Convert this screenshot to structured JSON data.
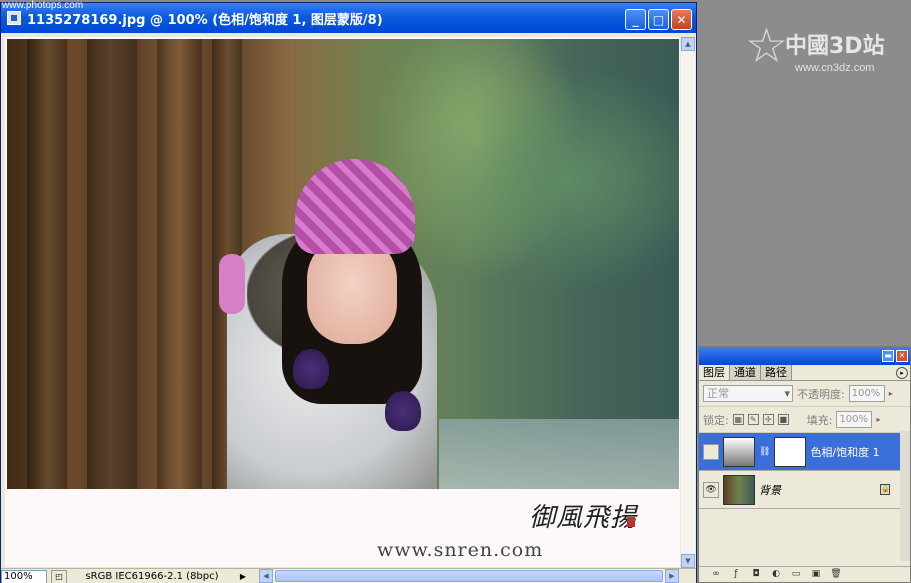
{
  "watermark_top": "www.photops.com",
  "window": {
    "title": "1135278169.jpg @ 100% (色相/饱和度 1, 图层蒙版/8)",
    "minimize_glyph": "_",
    "maximize_glyph": "□",
    "close_glyph": "✕"
  },
  "image": {
    "signature": "御風飛揚",
    "url": "www.snren.com"
  },
  "status": {
    "zoom": "100%",
    "profile": "sRGB IEC61966-2.1 (8bpc)"
  },
  "logo": {
    "text": "中國3D站",
    "url": "www.cn3dz.com"
  },
  "layers_panel": {
    "tabs": [
      {
        "label": "图层"
      },
      {
        "label": "通道"
      },
      {
        "label": "路径"
      }
    ],
    "blend_mode": "正常",
    "opacity_label": "不透明度:",
    "opacity_value": "100%",
    "lock_label": "锁定:",
    "fill_label": "填充:",
    "fill_value": "100%",
    "layers": [
      {
        "name": "色相/饱和度 1",
        "selected": true
      },
      {
        "name": "背景",
        "selected": false
      }
    ]
  },
  "icons": {
    "doc": "photoshop-doc-icon",
    "eye": "eye-icon",
    "lock": "lock-icon",
    "link": "link-icon"
  },
  "colors": {
    "titlebar": "#0a5be0",
    "selected_layer": "#3a6fd9"
  }
}
